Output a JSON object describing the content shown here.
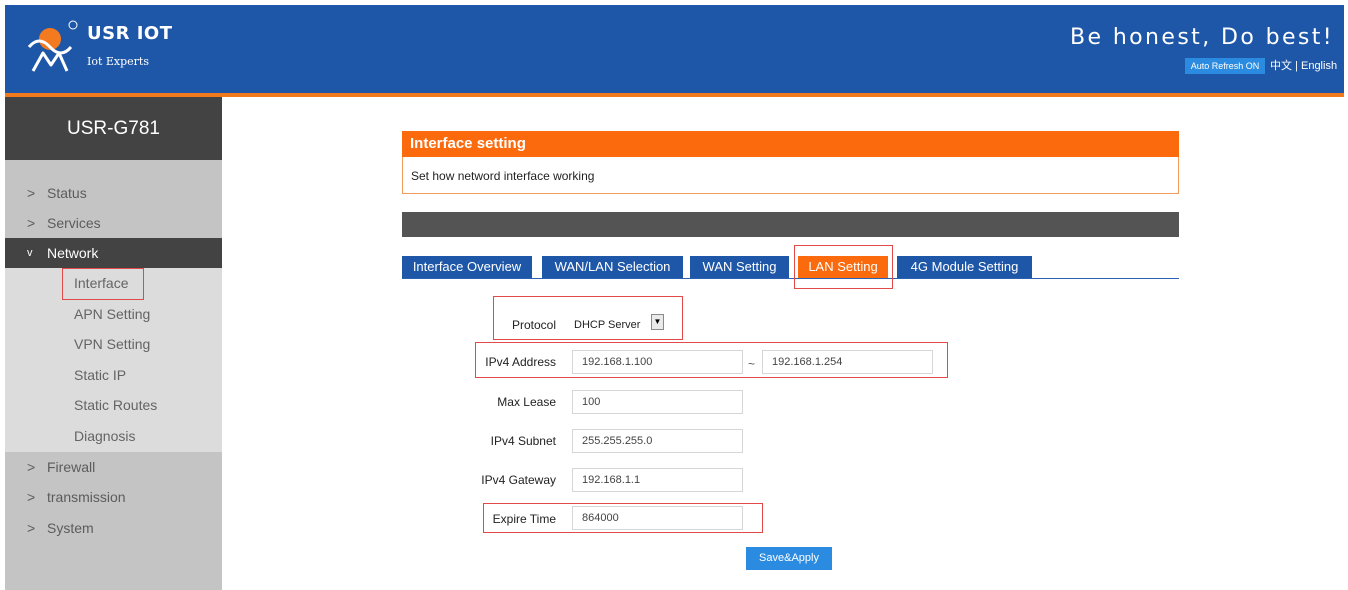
{
  "header": {
    "brand": "USR IOT",
    "brand_sub": "Iot Experts",
    "slogan": "Be honest, Do best!",
    "auto_refresh": "Auto Refresh ON",
    "lang_cn": "中文",
    "lang_sep": "|",
    "lang_en": "English",
    "colors": {
      "header_bg": "#1f57a8",
      "accent": "#f07a1c",
      "button": "#2a8be0"
    }
  },
  "sidebar": {
    "device": "USR-G781",
    "items": [
      {
        "chev": ">",
        "label": "Status"
      },
      {
        "chev": ">",
        "label": "Services"
      },
      {
        "chev": "v",
        "label": "Network"
      },
      {
        "chev": ">",
        "label": "Firewall"
      },
      {
        "chev": ">",
        "label": "transmission"
      },
      {
        "chev": ">",
        "label": "System"
      }
    ],
    "network_sub": [
      "Interface",
      "APN Setting",
      "VPN Setting",
      "Static IP",
      "Static Routes",
      "Diagnosis"
    ]
  },
  "panel": {
    "title": "Interface setting",
    "description": "Set how netword interface working"
  },
  "tabs": [
    "Interface Overview",
    "WAN/LAN Selection",
    "WAN Setting",
    "LAN Setting",
    "4G Module Setting"
  ],
  "form": {
    "protocol_label": "Protocol",
    "protocol_value": "DHCP Server",
    "ipv4_address_label": "IPv4 Address",
    "ipv4_start": "192.168.1.100",
    "range_sep": "~",
    "ipv4_end": "192.168.1.254",
    "max_lease_label": "Max Lease",
    "max_lease": "100",
    "ipv4_subnet_label": "IPv4 Subnet",
    "ipv4_subnet": "255.255.255.0",
    "ipv4_gateway_label": "IPv4 Gateway",
    "ipv4_gateway": "192.168.1.1",
    "expire_time_label": "Expire Time",
    "expire_time": "864000",
    "save_label": "Save&Apply"
  }
}
